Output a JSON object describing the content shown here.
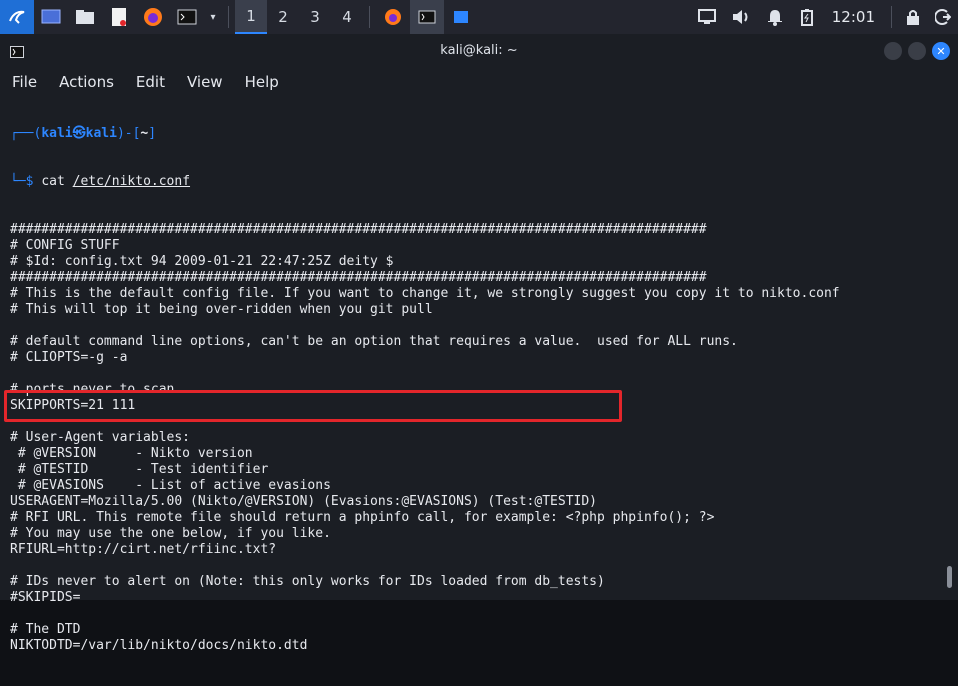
{
  "taskbar": {
    "workspaces": [
      "1",
      "2",
      "3",
      "4"
    ],
    "clock": "12:01",
    "icons": [
      "kali-menu-icon",
      "desktop-icon",
      "files-icon",
      "editor-icon",
      "firefox-icon",
      "terminal-icon",
      "firefox-task-icon",
      "terminal-task-icon",
      "app-task-icon",
      "display-icon",
      "volume-icon",
      "notifications-icon",
      "battery-icon",
      "lock-icon",
      "logout-icon"
    ]
  },
  "window": {
    "title": "kali@kali: ~"
  },
  "menubar": {
    "file": "File",
    "actions": "Actions",
    "edit": "Edit",
    "view": "View",
    "help": "Help"
  },
  "prompt": {
    "bar_top": "┌──(",
    "user": "kali㉿kali",
    "mid": ")-[",
    "dir": "~",
    "end": "]",
    "bar_bottom": "└─$ ",
    "command": "cat ",
    "path": "/etc/nikto.conf"
  },
  "lines": [
    "#########################################################################################",
    "# CONFIG STUFF",
    "# $Id: config.txt 94 2009-01-21 22:47:25Z deity $",
    "#########################################################################################",
    "# This is the default config file. If you want to change it, we strongly suggest you copy it to nikto.conf",
    "# This will top it being over-ridden when you git pull",
    "",
    "# default command line options, can't be an option that requires a value.  used for ALL runs.",
    "# CLIOPTS=-g -a",
    "",
    "# ports never to scan",
    "SKIPPORTS=21 111",
    "",
    "# User-Agent variables:",
    " # @VERSION     - Nikto version",
    " # @TESTID      - Test identifier",
    " # @EVASIONS    - List of active evasions",
    "USERAGENT=Mozilla/5.00 (Nikto/@VERSION) (Evasions:@EVASIONS) (Test:@TESTID)",
    "# RFI URL. This remote file should return a phpinfo call, for example: <?php phpinfo(); ?>",
    "# You may use the one below, if you like.",
    "RFIURL=http://cirt.net/rfiinc.txt?",
    "",
    "# IDs never to alert on (Note: this only works for IDs loaded from db_tests)",
    "#SKIPIDS=",
    "",
    "# The DTD",
    "NIKTODTD=/var/lib/nikto/docs/nikto.dtd"
  ]
}
